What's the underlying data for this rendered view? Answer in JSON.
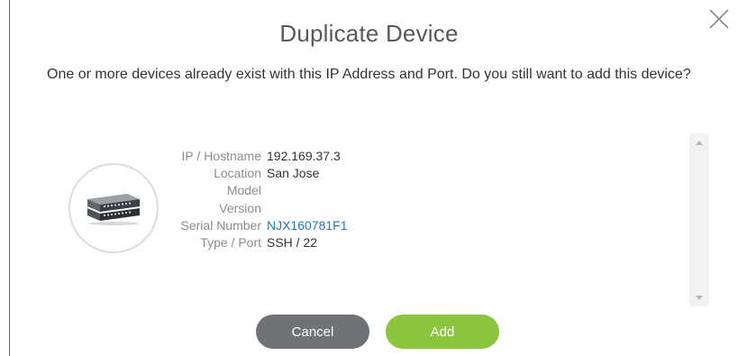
{
  "dialog": {
    "title": "Duplicate Device",
    "message": "One or more devices already exist with this IP Address and Port. Do you still want to add this device?"
  },
  "device": {
    "icon": "network-switch-icon",
    "fields": [
      {
        "label": "IP / Hostname",
        "value": "192.169.37.3"
      },
      {
        "label": "Location",
        "value": "San Jose"
      },
      {
        "label": "Model",
        "value": ""
      },
      {
        "label": "Version",
        "value": ""
      },
      {
        "label": "Serial Number",
        "value": "NJX160781F1"
      },
      {
        "label": "Type / Port",
        "value": "SSH / 22"
      }
    ]
  },
  "buttons": {
    "cancel_label": "Cancel",
    "add_label": "Add"
  },
  "colors": {
    "add_button": "#8cc63f",
    "cancel_button": "#6f7378",
    "link": "#1f7ab8"
  }
}
